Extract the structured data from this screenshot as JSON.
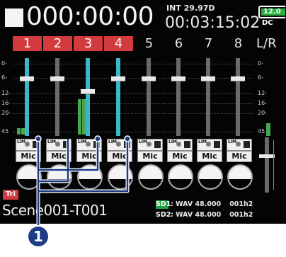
{
  "header": {
    "main_timecode": "000:00:00",
    "fps_label": "INT 29.97D",
    "timecode": "00:03:15:02",
    "battery": "12.0",
    "power": "DC"
  },
  "channels": [
    {
      "label": "1",
      "armed": true,
      "fader_level": 0.76,
      "meter": 0.08,
      "cyan_track": true,
      "pan_label": "Mic"
    },
    {
      "label": "2",
      "armed": true,
      "fader_level": 0.76,
      "meter": 0.0,
      "cyan_track": false,
      "pan_label": "Mic"
    },
    {
      "label": "3",
      "armed": true,
      "fader_level": 0.6,
      "meter": 0.45,
      "cyan_track": true,
      "pan_label": "Mic"
    },
    {
      "label": "4",
      "armed": true,
      "fader_level": 0.76,
      "meter": 0.0,
      "cyan_track": true,
      "pan_label": "Mic"
    },
    {
      "label": "5",
      "armed": false,
      "fader_level": 0.76,
      "meter": 0.0,
      "cyan_track": false,
      "pan_label": "Mic"
    },
    {
      "label": "6",
      "armed": false,
      "fader_level": 0.76,
      "meter": 0.0,
      "cyan_track": false,
      "pan_label": "Mic"
    },
    {
      "label": "7",
      "armed": false,
      "fader_level": 0.76,
      "meter": 0.0,
      "cyan_track": false,
      "pan_label": "Mic"
    },
    {
      "label": "8",
      "armed": false,
      "fader_level": 0.76,
      "meter": 0.0,
      "cyan_track": false,
      "pan_label": "Mic"
    }
  ],
  "lr": {
    "label": "L/R"
  },
  "meter_scale": [
    "0-",
    "6-",
    "12-",
    "16-",
    "20-",
    "45"
  ],
  "icon_labels": {
    "limiter": "LIM"
  },
  "trim_label": "Tri",
  "footer": {
    "scene": "Scene001-T001",
    "sd1": {
      "tag": "SD1",
      "format": ": WAV 48.000",
      "remain": "001h2"
    },
    "sd2": {
      "tag": "SD2",
      "format": ": WAV 48.000",
      "remain": "001h2"
    }
  },
  "callout": {
    "number": "1"
  },
  "colors": {
    "armed": "#d33a3d",
    "track_active": "#3cb7c7",
    "meter": "#48a64f",
    "sd1": "#1f9e44",
    "callout": "#1c3d83"
  }
}
